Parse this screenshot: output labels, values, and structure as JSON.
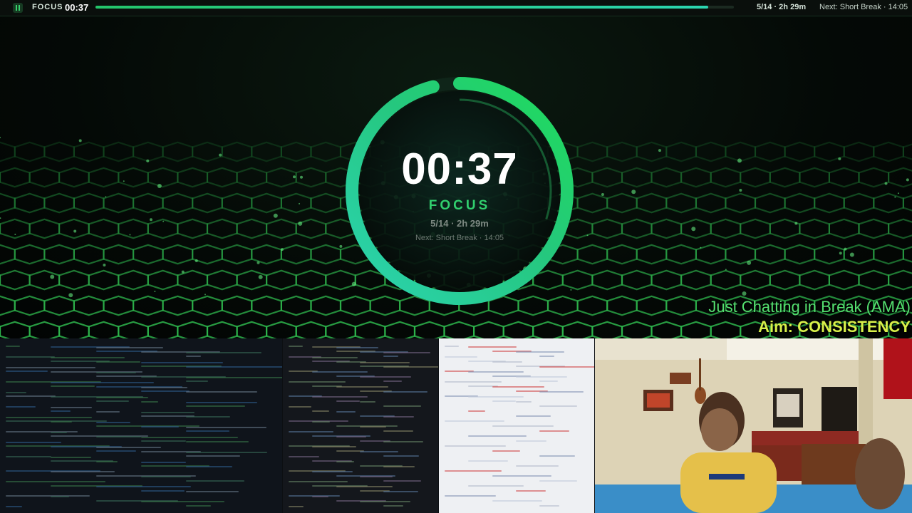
{
  "topbar": {
    "mode": "FOCUS",
    "time": "00:37",
    "progress": 0.96,
    "session": "5/14 · 2h 29m",
    "next": "Next: Short Break · 14:05"
  },
  "timer": {
    "time": "00:37",
    "mode": "FOCUS",
    "session": "5/14 · 2h 29m",
    "next": "Next: Short Break · 14:05",
    "progress": 0.96
  },
  "overlay": {
    "chat_line": "Just Chatting in Break (AMA)",
    "aim_line": "Aim: CONSISTENCY"
  },
  "colors": {
    "accent_green": "#31cf6e",
    "accent_teal": "#2bd4b0",
    "chat_text": "#55e070",
    "aim_text": "#d8f04a"
  },
  "icons": {
    "app_icon": "pomodoro-app-icon"
  }
}
